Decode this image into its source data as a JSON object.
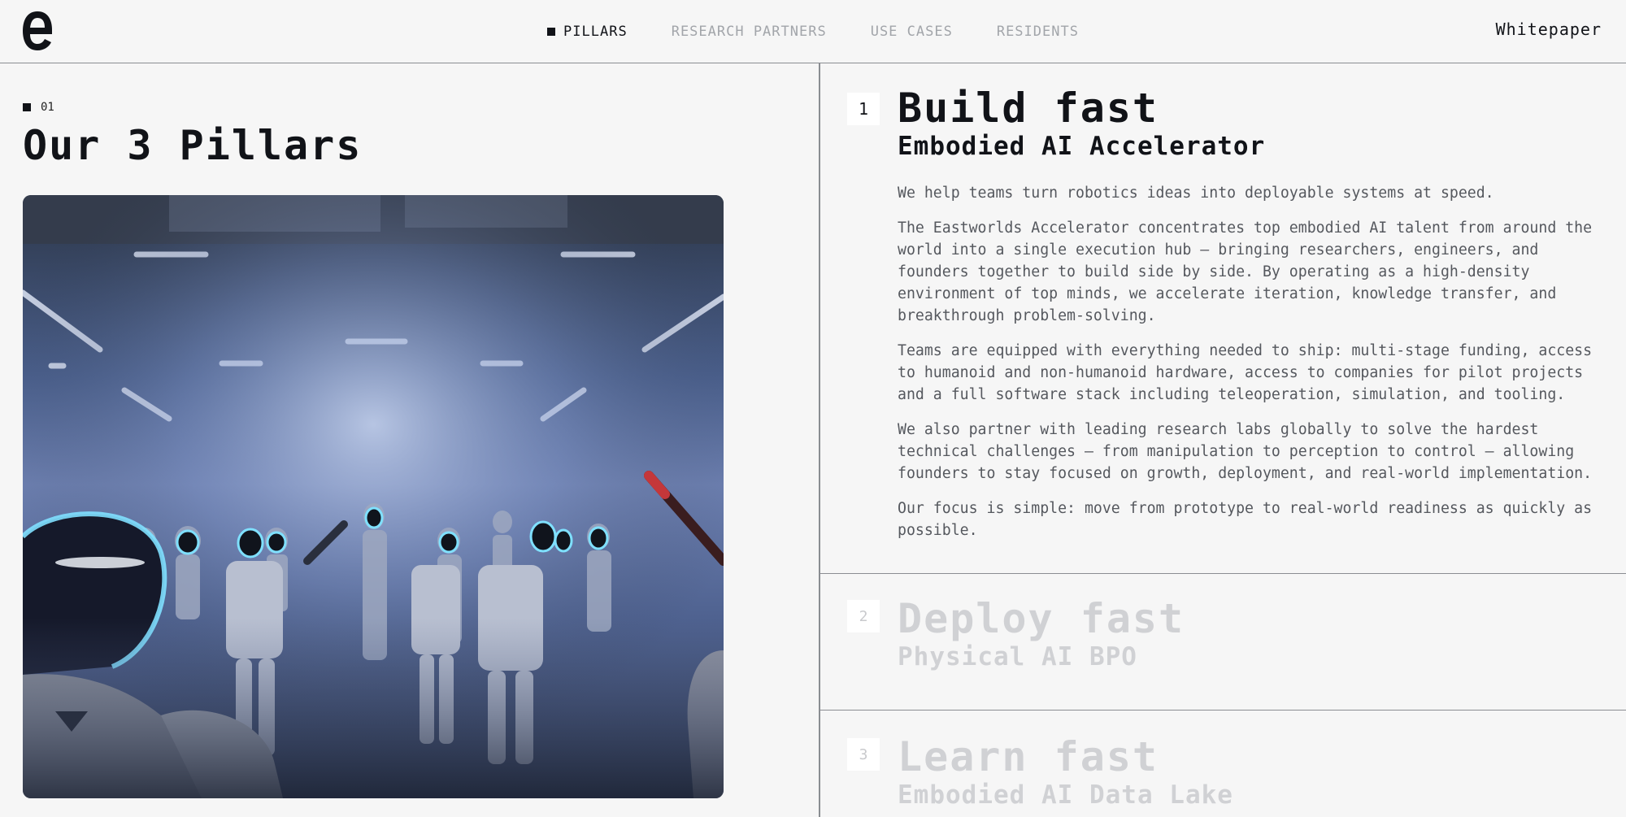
{
  "brand": {
    "logo_glyph": "e"
  },
  "nav": {
    "items": [
      {
        "label": "PILLARS",
        "active": true
      },
      {
        "label": "RESEARCH PARTNERS",
        "active": false
      },
      {
        "label": "USE CASES",
        "active": false
      },
      {
        "label": "RESIDENTS",
        "active": false
      }
    ],
    "cta_label": "Whitepaper"
  },
  "section": {
    "index": "01",
    "title": "Our 3 Pillars",
    "hero_image_alt": "Rows of humanoid robots with glowing visors in a warehouse"
  },
  "pillars": [
    {
      "number": "1",
      "title": "Build fast",
      "subtitle": "Embodied AI Accelerator",
      "expanded": true,
      "paragraphs": [
        "We help teams turn robotics ideas into deployable systems at speed.",
        "The Eastworlds Accelerator concentrates top embodied AI talent from around the world into a single execution hub — bringing researchers, engineers, and founders together to build side by side. By operating as a high-density environment of top minds, we accelerate iteration, knowledge transfer, and breakthrough problem-solving.",
        "Teams are equipped with everything needed to ship: multi-stage funding, access to humanoid and non-humanoid hardware, access to companies for pilot projects and a full software stack including teleoperation, simulation, and tooling.",
        "We also partner with leading research labs globally to solve the hardest technical challenges — from manipulation to perception to control — allowing founders to stay focused on growth, deployment, and real-world implementation.",
        "Our focus is simple: move from prototype to real-world readiness as quickly as possible."
      ]
    },
    {
      "number": "2",
      "title": "Deploy fast",
      "subtitle": "Physical AI BPO",
      "expanded": false
    },
    {
      "number": "3",
      "title": "Learn fast",
      "subtitle": "Embodied AI Data Lake",
      "expanded": false
    }
  ],
  "colors": {
    "background": "#f6f6f6",
    "text": "#111318",
    "muted_nav": "#a2a5aa",
    "collapsed_title": "#d0d1d4",
    "divider": "#8a8d92",
    "visor_glow": "#7fe0ff"
  }
}
